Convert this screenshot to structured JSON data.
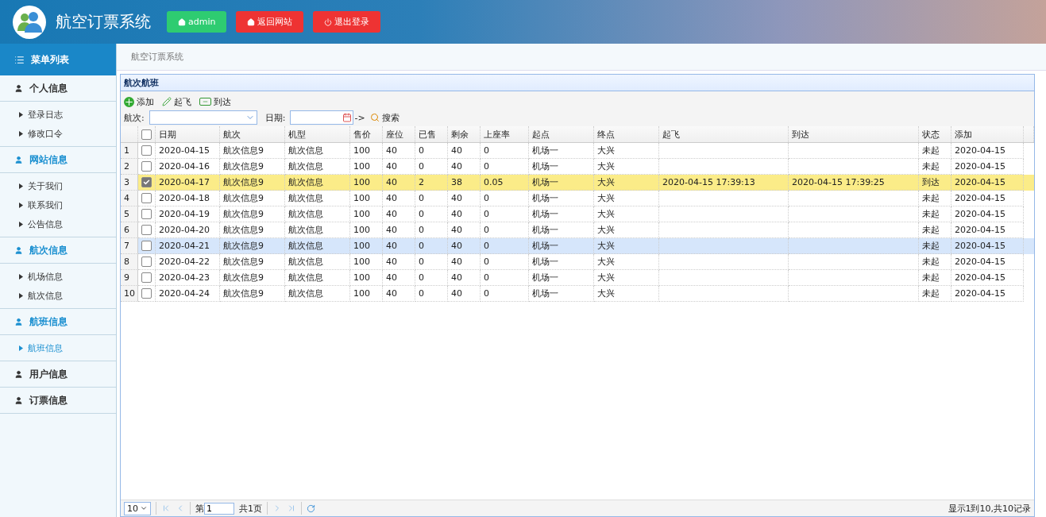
{
  "header": {
    "title": "航空订票系统",
    "buttons": [
      {
        "label": "admin",
        "kind": "home",
        "color": "#2ecc71"
      },
      {
        "label": "返回网站",
        "kind": "home",
        "color": "#ee3333"
      },
      {
        "label": "退出登录",
        "kind": "power",
        "color": "#ee3333"
      }
    ]
  },
  "sidebar": {
    "title": "菜单列表",
    "groups": [
      {
        "label": "个人信息",
        "highlighted": false,
        "children": [
          {
            "label": "登录日志",
            "selected": false
          },
          {
            "label": "修改口令",
            "selected": false
          }
        ]
      },
      {
        "label": "网站信息",
        "highlighted": true,
        "children": [
          {
            "label": "关于我们",
            "selected": false
          },
          {
            "label": "联系我们",
            "selected": false
          },
          {
            "label": "公告信息",
            "selected": false
          }
        ]
      },
      {
        "label": "航次信息",
        "highlighted": true,
        "children": [
          {
            "label": "机场信息",
            "selected": false
          },
          {
            "label": "航次信息",
            "selected": false
          }
        ]
      },
      {
        "label": "航班信息",
        "highlighted": true,
        "children": [
          {
            "label": "航班信息",
            "selected": true
          }
        ]
      },
      {
        "label": "用户信息",
        "highlighted": false
      },
      {
        "label": "订票信息",
        "highlighted": false
      }
    ]
  },
  "breadcrumb": "航空订票系统",
  "panel": {
    "title": "航次航班",
    "toolbar": [
      {
        "label": "添加",
        "kind": "add"
      },
      {
        "label": "起飞",
        "kind": "edit"
      },
      {
        "label": "到达",
        "kind": "minus"
      }
    ],
    "filters": {
      "flight_label": "航次:",
      "date_label": "日期:",
      "arrow": "->",
      "search": "搜索"
    },
    "table": {
      "all_checked": false,
      "columns": [
        "日期",
        "航次",
        "机型",
        "售价",
        "座位",
        "已售",
        "剩余",
        "上座率",
        "起点",
        "终点",
        "起飞",
        "到达",
        "状态",
        "添加"
      ],
      "rows": [
        {
          "number": "1",
          "checked": false,
          "selected": false,
          "hovered": false,
          "cells": [
            "2020-04-15",
            "航次信息9",
            "航次信息",
            "100",
            "40",
            "0",
            "40",
            "0",
            "机场一",
            "大兴",
            "",
            "",
            "未起",
            "2020-04-15"
          ]
        },
        {
          "number": "2",
          "checked": false,
          "selected": false,
          "hovered": false,
          "cells": [
            "2020-04-16",
            "航次信息9",
            "航次信息",
            "100",
            "40",
            "0",
            "40",
            "0",
            "机场一",
            "大兴",
            "",
            "",
            "未起",
            "2020-04-15"
          ]
        },
        {
          "number": "3",
          "checked": true,
          "selected": true,
          "hovered": false,
          "cells": [
            "2020-04-17",
            "航次信息9",
            "航次信息",
            "100",
            "40",
            "2",
            "38",
            "0.05",
            "机场一",
            "大兴",
            "2020-04-15 17:39:13",
            "2020-04-15 17:39:25",
            "到达",
            "2020-04-15"
          ]
        },
        {
          "number": "4",
          "checked": false,
          "selected": false,
          "hovered": false,
          "cells": [
            "2020-04-18",
            "航次信息9",
            "航次信息",
            "100",
            "40",
            "0",
            "40",
            "0",
            "机场一",
            "大兴",
            "",
            "",
            "未起",
            "2020-04-15"
          ]
        },
        {
          "number": "5",
          "checked": false,
          "selected": false,
          "hovered": false,
          "cells": [
            "2020-04-19",
            "航次信息9",
            "航次信息",
            "100",
            "40",
            "0",
            "40",
            "0",
            "机场一",
            "大兴",
            "",
            "",
            "未起",
            "2020-04-15"
          ]
        },
        {
          "number": "6",
          "checked": false,
          "selected": false,
          "hovered": false,
          "cells": [
            "2020-04-20",
            "航次信息9",
            "航次信息",
            "100",
            "40",
            "0",
            "40",
            "0",
            "机场一",
            "大兴",
            "",
            "",
            "未起",
            "2020-04-15"
          ]
        },
        {
          "number": "7",
          "checked": false,
          "selected": false,
          "hovered": true,
          "cells": [
            "2020-04-21",
            "航次信息9",
            "航次信息",
            "100",
            "40",
            "0",
            "40",
            "0",
            "机场一",
            "大兴",
            "",
            "",
            "未起",
            "2020-04-15"
          ]
        },
        {
          "number": "8",
          "checked": false,
          "selected": false,
          "hovered": false,
          "cells": [
            "2020-04-22",
            "航次信息9",
            "航次信息",
            "100",
            "40",
            "0",
            "40",
            "0",
            "机场一",
            "大兴",
            "",
            "",
            "未起",
            "2020-04-15"
          ]
        },
        {
          "number": "9",
          "checked": false,
          "selected": false,
          "hovered": false,
          "cells": [
            "2020-04-23",
            "航次信息9",
            "航次信息",
            "100",
            "40",
            "0",
            "40",
            "0",
            "机场一",
            "大兴",
            "",
            "",
            "未起",
            "2020-04-15"
          ]
        },
        {
          "number": "10",
          "checked": false,
          "selected": false,
          "hovered": false,
          "cells": [
            "2020-04-24",
            "航次信息9",
            "航次信息",
            "100",
            "40",
            "0",
            "40",
            "0",
            "机场一",
            "大兴",
            "",
            "",
            "未起",
            "2020-04-15"
          ]
        }
      ]
    },
    "pager": {
      "page_size": "10",
      "page_prefix": "第",
      "page": "1",
      "page_total": "共1页",
      "info": "显示1到10,共10记录"
    }
  }
}
